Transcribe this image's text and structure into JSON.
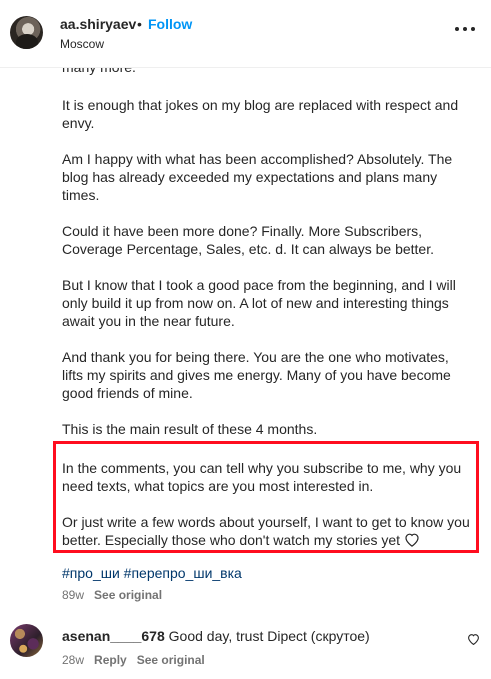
{
  "header": {
    "username": "aa.shiryaev",
    "separator": "•",
    "follow_label": "Follow",
    "location": "Moscow",
    "more_icon": "more-horizontal-icon"
  },
  "post": {
    "partial_top": "many more.",
    "paragraphs": [
      "It is enough that jokes on my blog are replaced with respect and envy.",
      "Am I happy with what has been accomplished? Absolutely. The blog has already exceeded my expectations and plans many times.",
      "Could it have been more done? Finally. More Subscribers, Coverage Percentage, Sales, etc. d. It can always be better.",
      "But I know that I took a good pace from the beginning, and I will only build it up from now on. A lot of new and interesting things await you in the near future.",
      "And thank you for being there. You are the one who motivates, lifts my spirits and gives me energy. Many of you have become good friends of mine.",
      "This is the main result of these 4 months."
    ],
    "highlighted": [
      "In the comments, you can tell why you subscribe to me, why you need texts, what topics are you most interested in.",
      "Or just write a few words about yourself, I want to get to know you better. Especially those who don't watch my stories yet"
    ],
    "hashtags": "#про_ши #перепро_ши_вка",
    "age": "89w",
    "see_original": "See original",
    "highlight_color": "#ff0d1f"
  },
  "comment": {
    "username": "asenan____678",
    "text": "Good day, trust Dipect (скрутое)",
    "age": "28w",
    "reply": "Reply",
    "see_original": "See original",
    "like_icon": "heart-outline-icon"
  }
}
